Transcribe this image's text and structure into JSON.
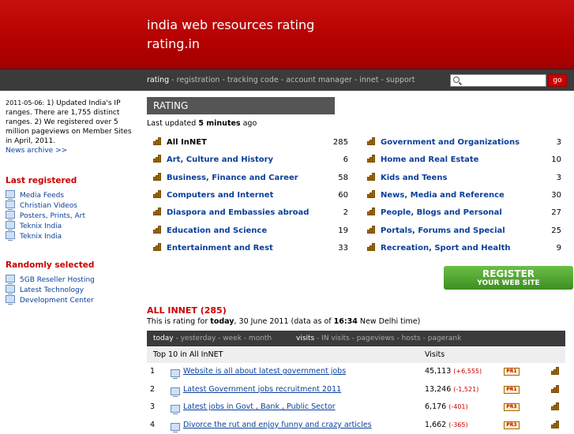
{
  "header": {
    "line1": "india web resources rating",
    "line2": "rating.in"
  },
  "nav": [
    {
      "label": "rating",
      "active": true
    },
    {
      "label": "registration"
    },
    {
      "label": "tracking code"
    },
    {
      "label": "account manager"
    },
    {
      "label": "innet"
    },
    {
      "label": "support"
    }
  ],
  "search": {
    "placeholder": "",
    "go_label": "go"
  },
  "sidebar": {
    "news_date": "2011-05-06:",
    "news_text": " 1) Updated India's IP ranges. There are 1,755 distinct ranges. 2) We registered over 5 million pageviews on Member Sites in April, 2011.",
    "archive_label": "News archive >>",
    "last_registered_title": "Last registered",
    "last_registered": [
      "Media Feeds",
      "Christian Videos",
      "Posters, Prints, Art",
      "Teknix India",
      "Teknix India"
    ],
    "random_title": "Randomly selected",
    "random": [
      "5GB Reseller Hosting",
      "Latest Technology",
      "Development Center"
    ]
  },
  "rating": {
    "tab_label": "RATING",
    "updated_prefix": "Last updated ",
    "updated_value": "5 minutes",
    "updated_suffix": " ago",
    "categories_left": [
      {
        "label": "All InNET",
        "count": "285"
      },
      {
        "label": "Art, Culture and History",
        "count": "6"
      },
      {
        "label": "Business, Finance and Career",
        "count": "58"
      },
      {
        "label": "Computers and Internet",
        "count": "60"
      },
      {
        "label": "Diaspora and Embassies abroad",
        "count": "2"
      },
      {
        "label": "Education and Science",
        "count": "19"
      },
      {
        "label": "Entertainment and Rest",
        "count": "33"
      }
    ],
    "categories_right": [
      {
        "label": "Government and Organizations",
        "count": "3"
      },
      {
        "label": "Home and Real Estate",
        "count": "10"
      },
      {
        "label": "Kids and Teens",
        "count": "3"
      },
      {
        "label": "News, Media and Reference",
        "count": "30"
      },
      {
        "label": "People, Blogs and Personal",
        "count": "27"
      },
      {
        "label": "Portals, Forums and Special",
        "count": "25"
      },
      {
        "label": "Recreation, Sport and Health",
        "count": "9"
      }
    ]
  },
  "register": {
    "line1": "REGISTER",
    "line2": "YOUR WEB SITE"
  },
  "all": {
    "heading": "ALL INNET (285)",
    "rating_for_1": "This is rating for ",
    "rating_for_today": "today",
    "rating_for_2": ", 30 June 2011 (data as of ",
    "rating_for_time": "16:34",
    "rating_for_3": " New Delhi time)",
    "period_tabs": [
      "today",
      "yesterday",
      "week",
      "month"
    ],
    "metric_tabs": [
      "visits",
      "IN visits",
      "pageviews",
      "hosts",
      "pagerank"
    ],
    "table_head": "Top 10 in All InNET",
    "visits_head": "Visits",
    "rows": [
      {
        "n": "1",
        "title": "Website is all about latest government jobs",
        "visits": "45,113",
        "delta": "(+6,555)",
        "pr": "PR1"
      },
      {
        "n": "2",
        "title": "Latest Government jobs recruitment 2011",
        "visits": "13,246",
        "delta": "(-1,521)",
        "pr": "PR1"
      },
      {
        "n": "3",
        "title": "Latest jobs in Govt , Bank , Public Sector",
        "visits": "6,176",
        "delta": "(-401)",
        "pr": "PR3"
      },
      {
        "n": "4",
        "title": "Divorce the rut and enjoy funny and crazy articles",
        "visits": "1,662",
        "delta": "(-365)",
        "pr": "PR3"
      }
    ]
  },
  "colors": {
    "header": "#b40000",
    "nav": "#3b3b3b",
    "accent": "#cc0000",
    "link": "#0b3f9a",
    "register": "#4fa22f"
  }
}
